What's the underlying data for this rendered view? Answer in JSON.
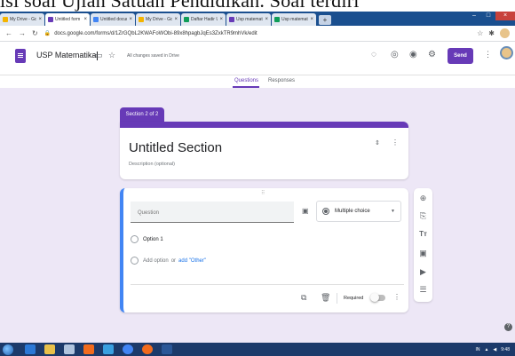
{
  "caption": "isi soal Ujian Satuan Pendidikan. Soal terdiri",
  "browser": {
    "tabs": [
      {
        "label": "My Drive - Googl",
        "color": "#f4b400",
        "active": false
      },
      {
        "label": "Untitled form - Go",
        "color": "#673ab7",
        "active": true
      },
      {
        "label": "Untitled documen",
        "color": "#4285f4",
        "active": false
      },
      {
        "label": "My Drive - Googl",
        "color": "#f4b400",
        "active": false
      },
      {
        "label": "Daftar Hadir Ujian",
        "color": "#0f9d58",
        "active": false
      },
      {
        "label": "Usp matematika",
        "color": "#673ab7",
        "active": false
      },
      {
        "label": "Usp matematika",
        "color": "#0f9d58",
        "active": false
      }
    ],
    "url": "docs.google.com/forms/d/1ZrGQbL2KWAFoWObi-89x8hpagbJqEs3ZxkTR9mhVk/edit"
  },
  "header": {
    "form_title": "USP Matematika",
    "saved_status": "All changes saved in Drive",
    "send_label": "Send",
    "tab_questions": "Questions",
    "tab_responses": "Responses"
  },
  "section": {
    "badge": "Section 2 of 2",
    "title": "Untitled Section",
    "description_placeholder": "Description (optional)"
  },
  "question": {
    "placeholder": "Question",
    "type": "Multiple choice",
    "option1": "Option 1",
    "add_option": "Add option",
    "or_text": "or",
    "add_other": "add \"Other\"",
    "required_label": "Required",
    "required": false
  },
  "toolbar": {
    "items": [
      "add-question",
      "import-questions",
      "add-title",
      "add-image",
      "add-video",
      "add-section"
    ]
  },
  "taskbar": {
    "tray_time": "9:48",
    "tray_lang": "IN"
  }
}
